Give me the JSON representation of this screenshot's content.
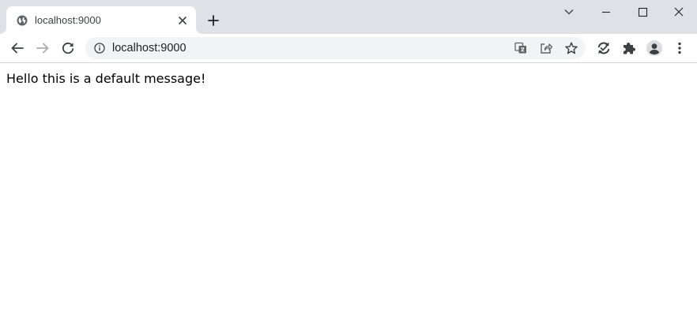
{
  "tab": {
    "title": "localhost:9000",
    "favicon_icon": "globe-icon",
    "close_icon": "close-icon"
  },
  "tabstrip": {
    "new_tab_icon": "plus-icon",
    "tab_search_icon": "chevron-down-icon",
    "window_controls": [
      "minimize-icon",
      "maximize-icon",
      "close-icon"
    ]
  },
  "toolbar": {
    "back_icon": "arrow-left-icon",
    "forward_icon": "arrow-right-icon",
    "reload_icon": "reload-icon",
    "extension_icons": [
      "sync-icon",
      "puzzle-icon",
      "profile-icon",
      "kebab-menu-icon"
    ]
  },
  "omnibox": {
    "site_info_icon": "info-icon",
    "url": "localhost:9000",
    "action_icons": [
      "translate-icon",
      "share-icon",
      "star-icon"
    ]
  },
  "page": {
    "message": "Hello this is a default message!"
  },
  "colors": {
    "tabstrip_bg": "#dee1e6",
    "omnibox_bg": "#f1f3f4",
    "icon": "#5f6368",
    "text": "#202124"
  }
}
